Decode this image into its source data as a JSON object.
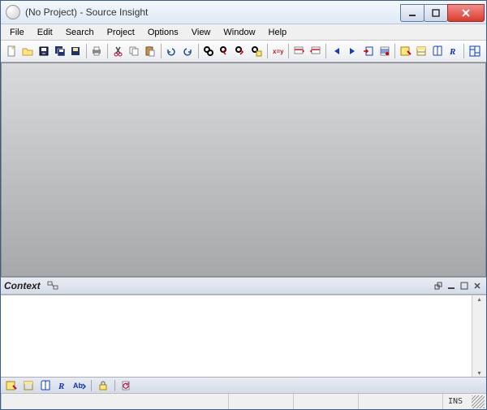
{
  "title": "(No Project) - Source Insight",
  "menu": [
    "File",
    "Edit",
    "Search",
    "Project",
    "Options",
    "View",
    "Window",
    "Help"
  ],
  "context": {
    "label": "Context"
  },
  "status": {
    "mode": "INS"
  }
}
